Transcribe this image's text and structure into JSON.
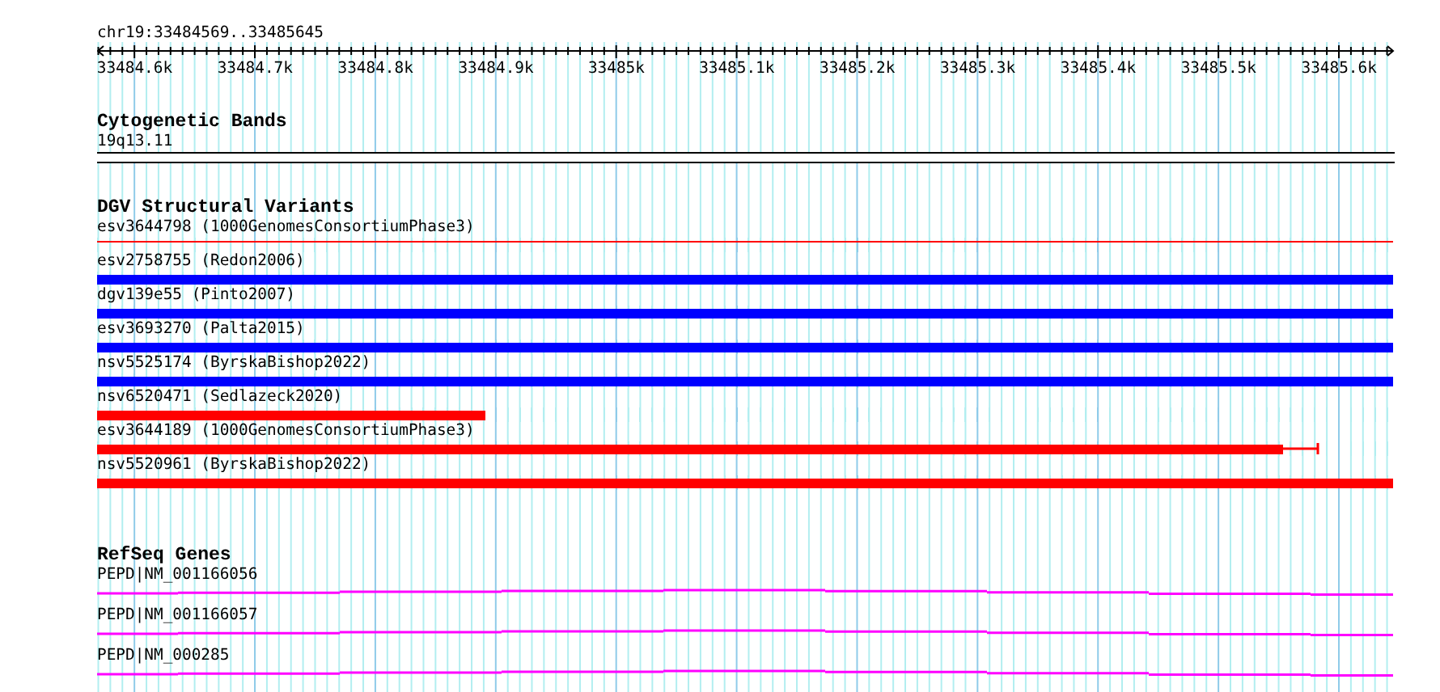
{
  "locus": "chr19:33484569..33485645",
  "ruler": {
    "labels": [
      "33484.6k",
      "33484.7k",
      "33484.8k",
      "33484.9k",
      "33485k",
      "33485.1k",
      "33485.2k",
      "33485.3k",
      "33485.4k",
      "33485.5k",
      "33485.6k"
    ]
  },
  "tracks": [
    {
      "title": "Cytogenetic Bands",
      "kind": "cytoband",
      "features": [
        {
          "label": "19q13.11"
        }
      ]
    },
    {
      "title": "DGV Structural Variants",
      "kind": "variants",
      "features": [
        {
          "label": "esv3644798 (1000GenomesConsortiumPhase3)",
          "kind": "line",
          "color": "#ff0000",
          "level": 1
        },
        {
          "label": "esv2758755 (Redon2006)",
          "kind": "bar",
          "color": "#0000ff",
          "level": 1
        },
        {
          "label": "dgv139e55 (Pinto2007)",
          "kind": "bar",
          "color": "#0000ff",
          "level": 1
        },
        {
          "label": "esv3693270 (Palta2015)",
          "kind": "bar",
          "color": "#0000ff",
          "level": 1
        },
        {
          "label": "nsv5525174 (ByrskaBishop2022)",
          "kind": "bar",
          "color": "#0000ff",
          "level": 1
        },
        {
          "label": "nsv6520471 (Sedlazeck2020)",
          "kind": "bar",
          "color": "#ff0000",
          "level": 0.3
        },
        {
          "label": "esv3644189 (1000GenomesConsortiumPhase3)",
          "kind": "bar_whisker",
          "color": "#ff0000",
          "level": 0.915
        },
        {
          "label": "nsv5520961 (ByrskaBishop2022)",
          "kind": "bar",
          "color": "#ff0000",
          "level": 1
        }
      ]
    },
    {
      "title": "RefSeq Genes",
      "kind": "genes",
      "features": [
        {
          "label": "PEPD|NM_001166056"
        },
        {
          "label": "PEPD|NM_001166057"
        },
        {
          "label": "PEPD|NM_000285"
        }
      ]
    }
  ]
}
